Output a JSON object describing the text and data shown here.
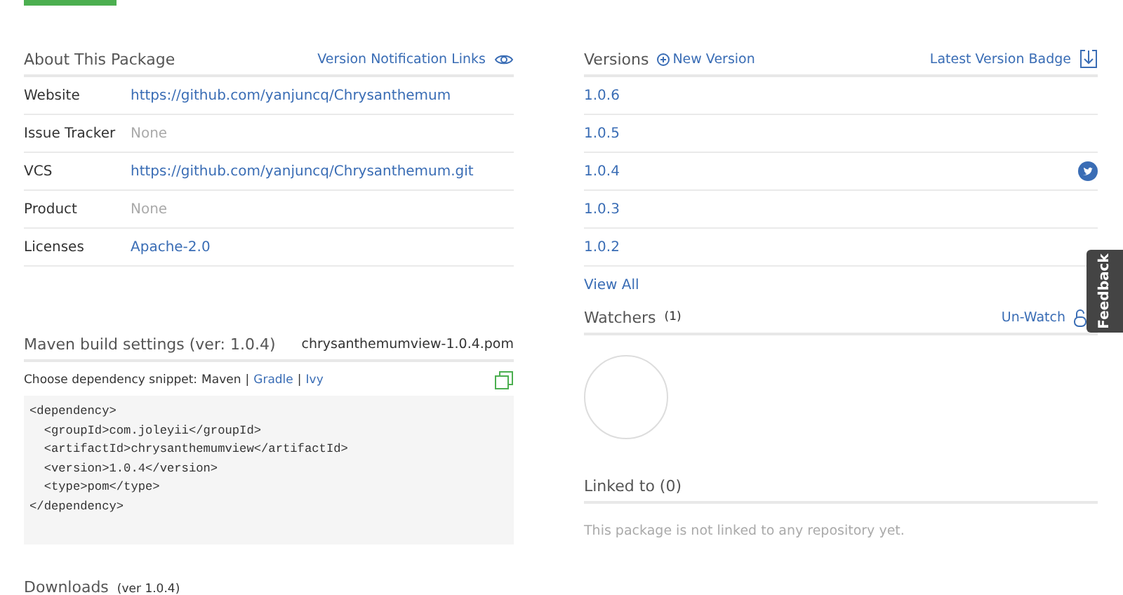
{
  "about": {
    "title": "About This Package",
    "notify_link": "Version Notification Links",
    "rows": [
      {
        "label": "Website",
        "value": "https://github.com/yanjuncq/Chrysanthemum",
        "kind": "link"
      },
      {
        "label": "Issue Tracker",
        "value": "None",
        "kind": "empty"
      },
      {
        "label": "VCS",
        "value": "https://github.com/yanjuncq/Chrysanthemum.git",
        "kind": "link"
      },
      {
        "label": "Product",
        "value": "None",
        "kind": "empty"
      },
      {
        "label": "Licenses",
        "value": "Apache-2.0",
        "kind": "link"
      }
    ]
  },
  "maven": {
    "title": "Maven build settings (ver: 1.0.4)",
    "file": "chrysanthemumview-1.0.4.pom",
    "prompt": "Choose dependency snippet:",
    "separator": "|",
    "options": [
      {
        "label": "Maven",
        "selected": true
      },
      {
        "label": "Gradle",
        "selected": false
      },
      {
        "label": "Ivy",
        "selected": false
      }
    ],
    "code": "<dependency>\n  <groupId>com.joleyii</groupId>\n  <artifactId>chrysanthemumview</artifactId>\n  <version>1.0.4</version>\n  <type>pom</type>\n</dependency>"
  },
  "downloads": {
    "title": "Downloads",
    "version": "(ver 1.0.4)"
  },
  "versions": {
    "title": "Versions",
    "new_link": "New Version",
    "badge_link": "Latest Version Badge",
    "items": [
      {
        "label": "1.0.6",
        "twitter": false
      },
      {
        "label": "1.0.5",
        "twitter": false
      },
      {
        "label": "1.0.4",
        "twitter": true
      },
      {
        "label": "1.0.3",
        "twitter": false
      },
      {
        "label": "1.0.2",
        "twitter": false
      }
    ],
    "view_all": "View All"
  },
  "watchers": {
    "title": "Watchers",
    "count": "(1)",
    "action": "Un-Watch"
  },
  "linked": {
    "title": "Linked to (0)",
    "message": "This package is not linked to any repository yet."
  },
  "feedback": "Feedback"
}
